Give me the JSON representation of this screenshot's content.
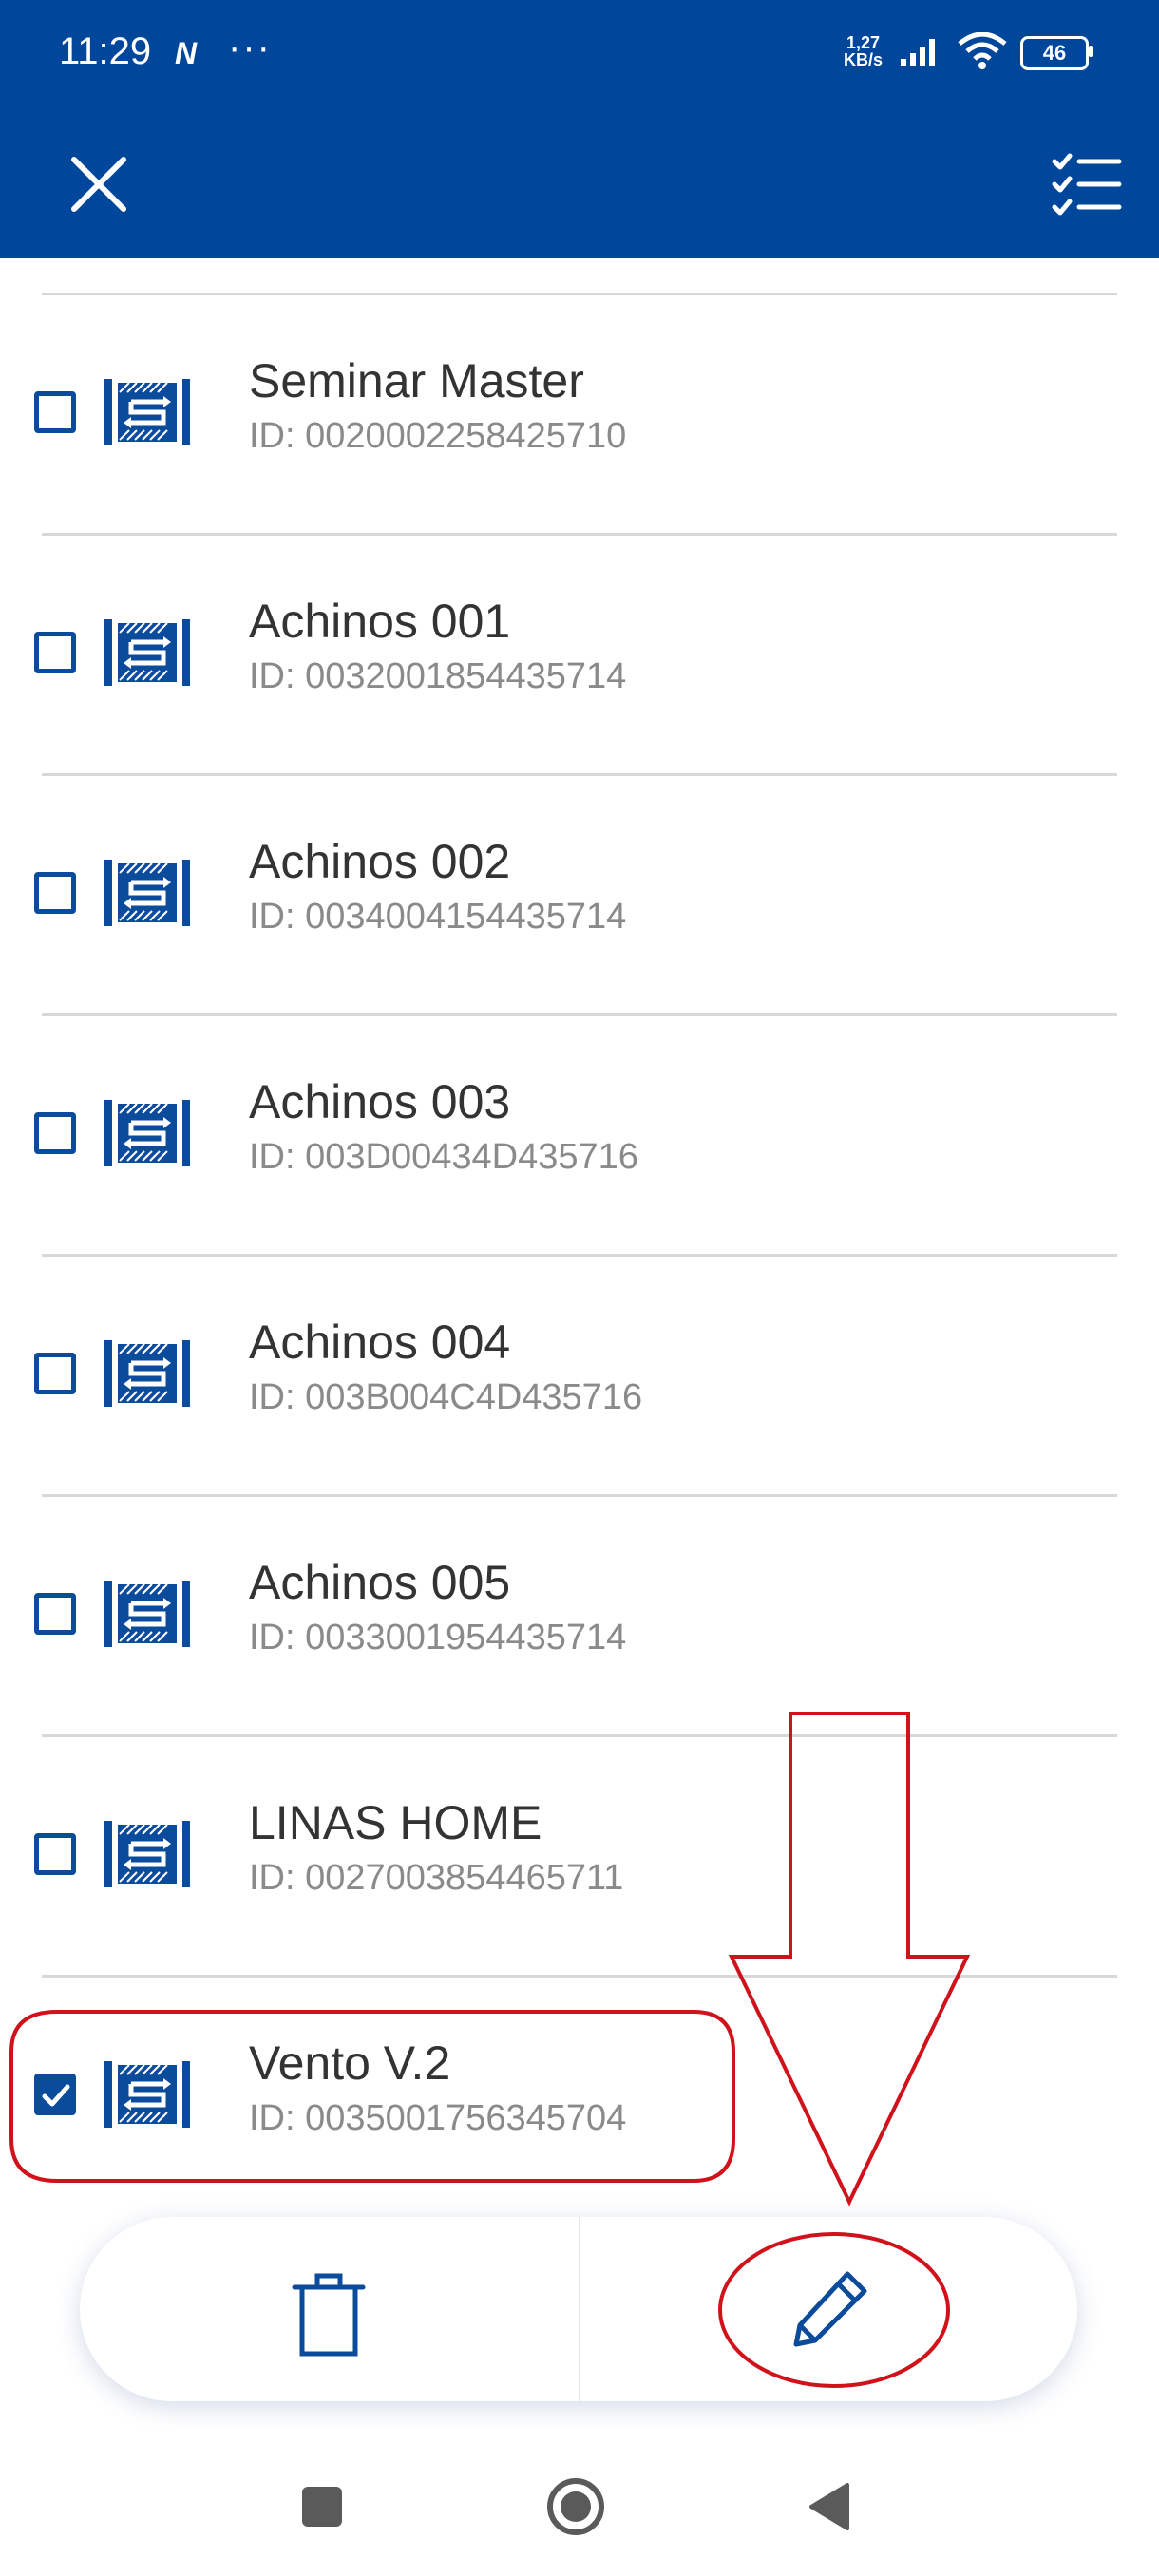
{
  "status_bar": {
    "time": "11:29",
    "nfc_icon": "N",
    "more": "···",
    "net_speed_value": "1,27",
    "net_speed_unit": "KB/s",
    "battery": "46"
  },
  "app_bar": {
    "close_icon": "close-icon",
    "select_all_icon": "checklist-icon",
    "background_color": "#00479b"
  },
  "devices": [
    {
      "name": "Seminar Master",
      "id": "ID: 0020002258425710",
      "checked": false
    },
    {
      "name": "Achinos 001",
      "id": "ID: 0032001854435714",
      "checked": false
    },
    {
      "name": "Achinos 002",
      "id": "ID: 0034004154435714",
      "checked": false
    },
    {
      "name": "Achinos 003",
      "id": "ID: 003D00434D435716",
      "checked": false
    },
    {
      "name": "Achinos 004",
      "id": "ID: 003B004C4D435716",
      "checked": false
    },
    {
      "name": "Achinos 005",
      "id": "ID: 0033001954435714",
      "checked": false
    },
    {
      "name": "LINAS HOME",
      "id": "ID: 0027003854465711",
      "checked": false
    },
    {
      "name": "Vento V.2",
      "id": "ID: 0035001756345704",
      "checked": true
    }
  ],
  "bottom_bar": {
    "delete_icon": "trash-icon",
    "edit_icon": "pencil-icon"
  },
  "colors": {
    "accent": "#0b4b9c",
    "annotation": "#d0121b"
  }
}
